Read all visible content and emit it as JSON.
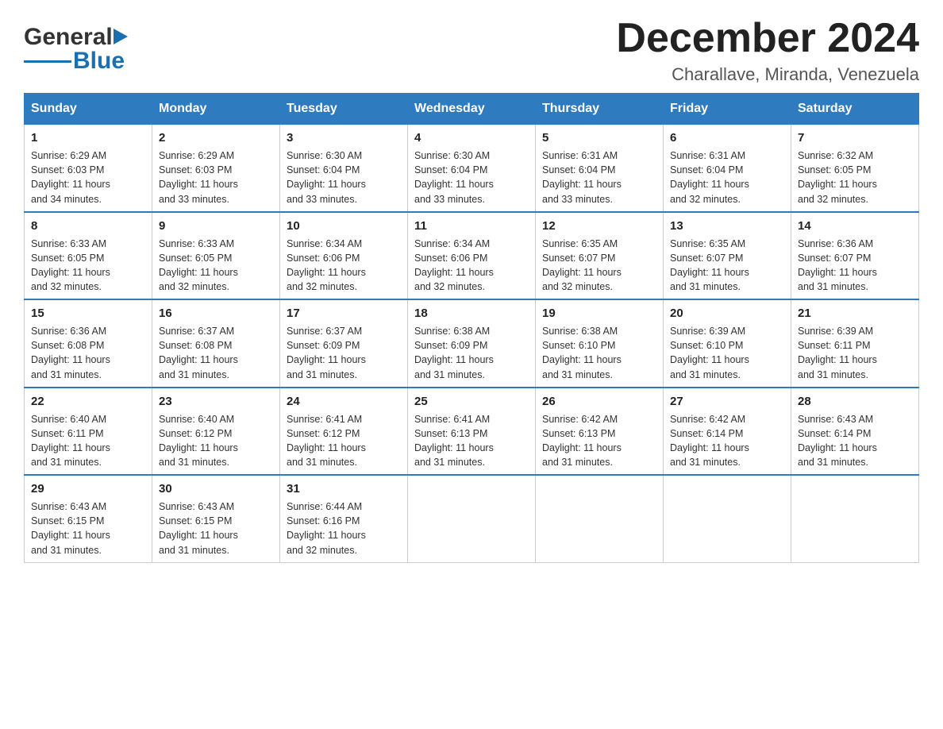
{
  "header": {
    "logo_general": "General",
    "logo_blue": "Blue",
    "month_title": "December 2024",
    "location": "Charallave, Miranda, Venezuela"
  },
  "days_of_week": [
    "Sunday",
    "Monday",
    "Tuesday",
    "Wednesday",
    "Thursday",
    "Friday",
    "Saturday"
  ],
  "weeks": [
    [
      {
        "day": "1",
        "sunrise": "6:29 AM",
        "sunset": "6:03 PM",
        "daylight": "11 hours and 34 minutes."
      },
      {
        "day": "2",
        "sunrise": "6:29 AM",
        "sunset": "6:03 PM",
        "daylight": "11 hours and 33 minutes."
      },
      {
        "day": "3",
        "sunrise": "6:30 AM",
        "sunset": "6:04 PM",
        "daylight": "11 hours and 33 minutes."
      },
      {
        "day": "4",
        "sunrise": "6:30 AM",
        "sunset": "6:04 PM",
        "daylight": "11 hours and 33 minutes."
      },
      {
        "day": "5",
        "sunrise": "6:31 AM",
        "sunset": "6:04 PM",
        "daylight": "11 hours and 33 minutes."
      },
      {
        "day": "6",
        "sunrise": "6:31 AM",
        "sunset": "6:04 PM",
        "daylight": "11 hours and 32 minutes."
      },
      {
        "day": "7",
        "sunrise": "6:32 AM",
        "sunset": "6:05 PM",
        "daylight": "11 hours and 32 minutes."
      }
    ],
    [
      {
        "day": "8",
        "sunrise": "6:33 AM",
        "sunset": "6:05 PM",
        "daylight": "11 hours and 32 minutes."
      },
      {
        "day": "9",
        "sunrise": "6:33 AM",
        "sunset": "6:05 PM",
        "daylight": "11 hours and 32 minutes."
      },
      {
        "day": "10",
        "sunrise": "6:34 AM",
        "sunset": "6:06 PM",
        "daylight": "11 hours and 32 minutes."
      },
      {
        "day": "11",
        "sunrise": "6:34 AM",
        "sunset": "6:06 PM",
        "daylight": "11 hours and 32 minutes."
      },
      {
        "day": "12",
        "sunrise": "6:35 AM",
        "sunset": "6:07 PM",
        "daylight": "11 hours and 32 minutes."
      },
      {
        "day": "13",
        "sunrise": "6:35 AM",
        "sunset": "6:07 PM",
        "daylight": "11 hours and 31 minutes."
      },
      {
        "day": "14",
        "sunrise": "6:36 AM",
        "sunset": "6:07 PM",
        "daylight": "11 hours and 31 minutes."
      }
    ],
    [
      {
        "day": "15",
        "sunrise": "6:36 AM",
        "sunset": "6:08 PM",
        "daylight": "11 hours and 31 minutes."
      },
      {
        "day": "16",
        "sunrise": "6:37 AM",
        "sunset": "6:08 PM",
        "daylight": "11 hours and 31 minutes."
      },
      {
        "day": "17",
        "sunrise": "6:37 AM",
        "sunset": "6:09 PM",
        "daylight": "11 hours and 31 minutes."
      },
      {
        "day": "18",
        "sunrise": "6:38 AM",
        "sunset": "6:09 PM",
        "daylight": "11 hours and 31 minutes."
      },
      {
        "day": "19",
        "sunrise": "6:38 AM",
        "sunset": "6:10 PM",
        "daylight": "11 hours and 31 minutes."
      },
      {
        "day": "20",
        "sunrise": "6:39 AM",
        "sunset": "6:10 PM",
        "daylight": "11 hours and 31 minutes."
      },
      {
        "day": "21",
        "sunrise": "6:39 AM",
        "sunset": "6:11 PM",
        "daylight": "11 hours and 31 minutes."
      }
    ],
    [
      {
        "day": "22",
        "sunrise": "6:40 AM",
        "sunset": "6:11 PM",
        "daylight": "11 hours and 31 minutes."
      },
      {
        "day": "23",
        "sunrise": "6:40 AM",
        "sunset": "6:12 PM",
        "daylight": "11 hours and 31 minutes."
      },
      {
        "day": "24",
        "sunrise": "6:41 AM",
        "sunset": "6:12 PM",
        "daylight": "11 hours and 31 minutes."
      },
      {
        "day": "25",
        "sunrise": "6:41 AM",
        "sunset": "6:13 PM",
        "daylight": "11 hours and 31 minutes."
      },
      {
        "day": "26",
        "sunrise": "6:42 AM",
        "sunset": "6:13 PM",
        "daylight": "11 hours and 31 minutes."
      },
      {
        "day": "27",
        "sunrise": "6:42 AM",
        "sunset": "6:14 PM",
        "daylight": "11 hours and 31 minutes."
      },
      {
        "day": "28",
        "sunrise": "6:43 AM",
        "sunset": "6:14 PM",
        "daylight": "11 hours and 31 minutes."
      }
    ],
    [
      {
        "day": "29",
        "sunrise": "6:43 AM",
        "sunset": "6:15 PM",
        "daylight": "11 hours and 31 minutes."
      },
      {
        "day": "30",
        "sunrise": "6:43 AM",
        "sunset": "6:15 PM",
        "daylight": "11 hours and 31 minutes."
      },
      {
        "day": "31",
        "sunrise": "6:44 AM",
        "sunset": "6:16 PM",
        "daylight": "11 hours and 32 minutes."
      },
      null,
      null,
      null,
      null
    ]
  ],
  "labels": {
    "sunrise": "Sunrise:",
    "sunset": "Sunset:",
    "daylight": "Daylight:"
  }
}
